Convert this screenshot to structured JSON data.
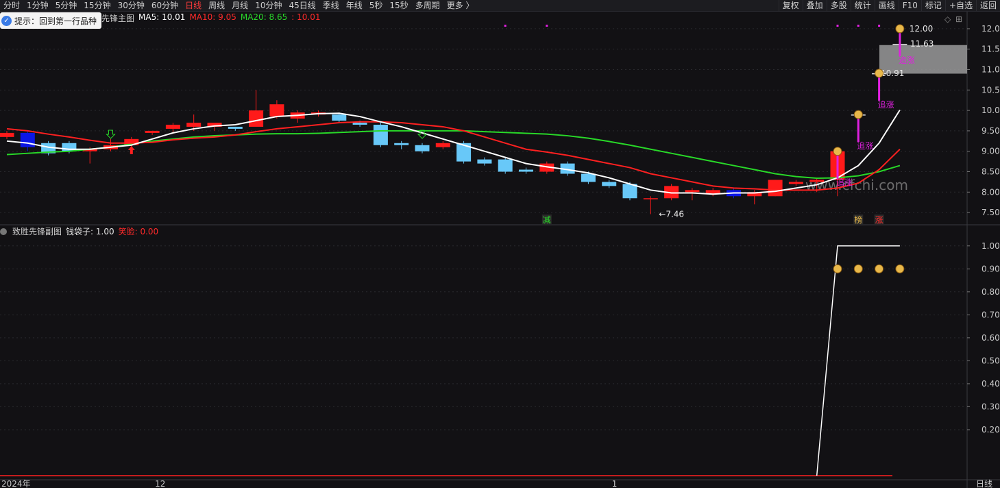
{
  "toolbar": {
    "periods": [
      "分时",
      "1分钟",
      "5分钟",
      "15分钟",
      "30分钟",
      "60分钟",
      "日线",
      "周线",
      "月线",
      "10分钟",
      "45日线",
      "季线",
      "年线",
      "5秒",
      "15秒",
      "多周期",
      "更多 〉"
    ],
    "active_period": "日线",
    "right_buttons": [
      "复权",
      "叠加",
      "多股",
      "统计",
      "画线",
      "F10",
      "标记",
      "+自选",
      "返回"
    ]
  },
  "tip": {
    "text": "提示：回到第一行品种"
  },
  "main_legend": {
    "title_partial": "先锋主图",
    "ma5": "MA5: 10.01",
    "ma10": "MA10: 9.05",
    "ma20": "MA20: 8.65",
    "extra": "10.01"
  },
  "sub_legend": {
    "title": "致胜先锋副图",
    "bag": "钱袋子: 1.00",
    "laugh": "笑脸: 0.00"
  },
  "watermark": "www.cfchi.com",
  "colors": {
    "up": "#ff1a1a",
    "down": "#68c8f8",
    "dark_down": "#0b16e6",
    "ma5": "#ffffff",
    "ma10": "#ff2020",
    "ma20": "#28d828",
    "signal": "#e020e0"
  },
  "chart_data": [
    {
      "type": "candlestick",
      "name": "main",
      "ylim": [
        7.25,
        12.2
      ],
      "yticks": [
        "12.00",
        "11.50",
        "11.00",
        "10.50",
        "10.00",
        "9.50",
        "9.00",
        "8.50",
        "8.00",
        "7.50"
      ],
      "candles": [
        [
          9.35,
          9.45,
          9.3,
          9.5
        ],
        [
          9.45,
          9.1,
          9.0,
          9.5
        ],
        [
          9.2,
          8.95,
          8.9,
          9.25
        ],
        [
          9.2,
          9.0,
          8.95,
          9.25
        ],
        [
          9.0,
          9.05,
          8.7,
          9.1
        ],
        [
          9.05,
          9.15,
          9.0,
          9.3
        ],
        [
          9.15,
          9.3,
          9.1,
          9.35
        ],
        [
          9.45,
          9.5,
          9.4,
          9.5
        ],
        [
          9.55,
          9.65,
          9.45,
          9.7
        ],
        [
          9.6,
          9.7,
          9.5,
          9.9
        ],
        [
          9.6,
          9.7,
          9.5,
          9.7
        ],
        [
          9.6,
          9.55,
          9.5,
          9.6
        ],
        [
          9.6,
          10.0,
          9.6,
          10.5
        ],
        [
          9.85,
          10.15,
          9.8,
          10.25
        ],
        [
          9.8,
          9.95,
          9.7,
          10.0
        ],
        [
          9.9,
          9.95,
          9.85,
          10.0
        ],
        [
          9.9,
          9.75,
          9.7,
          9.95
        ],
        [
          9.7,
          9.65,
          9.6,
          9.75
        ],
        [
          9.65,
          9.15,
          9.1,
          9.7
        ],
        [
          9.2,
          9.15,
          9.05,
          9.25
        ],
        [
          9.15,
          9.0,
          8.95,
          9.2
        ],
        [
          9.1,
          9.2,
          9.05,
          9.25
        ],
        [
          9.2,
          8.75,
          8.7,
          9.25
        ],
        [
          8.8,
          8.7,
          8.65,
          8.85
        ],
        [
          8.8,
          8.5,
          8.45,
          8.85
        ],
        [
          8.55,
          8.5,
          8.45,
          8.6
        ],
        [
          8.5,
          8.7,
          8.45,
          8.75
        ],
        [
          8.7,
          8.45,
          8.4,
          8.75
        ],
        [
          8.45,
          8.25,
          8.2,
          8.5
        ],
        [
          8.25,
          8.15,
          8.1,
          8.3
        ],
        [
          8.2,
          7.85,
          7.8,
          8.25
        ],
        [
          7.85,
          7.85,
          7.46,
          7.9
        ],
        [
          7.85,
          8.15,
          7.8,
          8.2
        ],
        [
          8.0,
          8.05,
          7.8,
          8.1
        ],
        [
          7.95,
          8.05,
          7.9,
          8.1
        ],
        [
          8.05,
          7.9,
          7.85,
          8.1
        ],
        [
          7.9,
          8.0,
          7.7,
          8.05
        ],
        [
          7.9,
          8.3,
          7.9,
          8.3
        ],
        [
          8.2,
          8.25,
          8.15,
          8.3
        ],
        [
          8.25,
          8.3,
          8.0,
          8.35
        ],
        [
          8.3,
          9.0,
          7.9,
          9.0
        ],
        [
          9.9,
          9.9,
          9.9,
          9.9
        ],
        [
          10.91,
          10.91,
          10.91,
          10.91
        ],
        [
          11.63,
          11.63,
          11.63,
          12.0
        ]
      ],
      "dark_down_index": [
        1,
        10,
        21,
        26,
        34,
        35
      ],
      "ma5": [
        9.25,
        9.2,
        9.1,
        9.05,
        9.05,
        9.1,
        9.15,
        9.3,
        9.45,
        9.55,
        9.62,
        9.65,
        9.75,
        9.85,
        9.88,
        9.92,
        9.93,
        9.85,
        9.72,
        9.6,
        9.45,
        9.3,
        9.15,
        9.0,
        8.85,
        8.7,
        8.62,
        8.55,
        8.47,
        8.35,
        8.2,
        8.05,
        7.98,
        7.98,
        7.95,
        7.98,
        7.98,
        8.02,
        8.1,
        8.18,
        8.35,
        8.65,
        9.2,
        10.01
      ],
      "ma10": [
        9.55,
        9.5,
        9.42,
        9.35,
        9.27,
        9.2,
        9.2,
        9.22,
        9.28,
        9.32,
        9.35,
        9.4,
        9.48,
        9.55,
        9.6,
        9.65,
        9.7,
        9.72,
        9.72,
        9.7,
        9.65,
        9.6,
        9.5,
        9.35,
        9.2,
        9.05,
        8.98,
        8.9,
        8.8,
        8.7,
        8.6,
        8.45,
        8.35,
        8.25,
        8.15,
        8.1,
        8.08,
        8.05,
        8.05,
        8.05,
        8.1,
        8.22,
        8.55,
        9.05
      ],
      "ma20": [
        8.92,
        8.95,
        8.98,
        9.0,
        9.05,
        9.1,
        9.18,
        9.25,
        9.3,
        9.35,
        9.38,
        9.4,
        9.42,
        9.43,
        9.43,
        9.44,
        9.46,
        9.48,
        9.5,
        9.5,
        9.5,
        9.5,
        9.5,
        9.48,
        9.46,
        9.44,
        9.42,
        9.38,
        9.32,
        9.24,
        9.15,
        9.05,
        8.95,
        8.85,
        8.75,
        8.65,
        8.55,
        8.45,
        8.38,
        8.34,
        8.35,
        8.4,
        8.5,
        8.65
      ],
      "price_labels": [
        {
          "text": "12.00",
          "value": 12.0
        },
        {
          "text": "11.63",
          "value": 11.63
        },
        {
          "text": "10.91",
          "value": 10.91
        },
        {
          "text": "7.46",
          "value": 7.46
        }
      ],
      "gray_box": {
        "from": 10.9,
        "to": 11.6
      },
      "signals": [
        {
          "index": 40,
          "text": "追涨"
        },
        {
          "index": 41,
          "text": "追涨"
        },
        {
          "index": 42,
          "text": "追涨"
        },
        {
          "index": 43,
          "text": "追涨"
        }
      ],
      "bottom_tags": [
        {
          "index": 26,
          "text": "减"
        },
        {
          "index": 41,
          "text": "榜"
        },
        {
          "index": 42,
          "text": "涨"
        }
      ],
      "buy_arrows": [
        6
      ],
      "hollow_down_arrows": [
        5,
        20
      ],
      "magenta_dots": [
        24,
        26,
        40,
        41,
        42
      ]
    },
    {
      "type": "line",
      "name": "sub",
      "ylim": [
        0.0,
        1.05
      ],
      "yticks": [
        "1.00",
        "0.90",
        "0.80",
        "0.70",
        "0.60",
        "0.50",
        "0.40",
        "0.30",
        "0.20"
      ],
      "values": [
        0,
        0,
        0,
        0,
        0,
        0,
        0,
        0,
        0,
        0,
        0,
        0,
        0,
        0,
        0,
        0,
        0,
        0,
        0,
        0,
        0,
        0,
        0,
        0,
        0,
        0,
        0,
        0,
        0,
        0,
        0,
        0,
        0,
        0,
        0,
        0,
        0,
        0,
        0,
        0,
        1,
        1,
        1,
        1
      ],
      "laugh": 0.0,
      "bag_icons_at": [
        40,
        41,
        42,
        43
      ],
      "bag_level": 0.9
    }
  ],
  "x_axis": {
    "labels": [
      {
        "text": "2024年",
        "index": 0
      },
      {
        "text": "12",
        "index": 7
      },
      {
        "text": "1",
        "index": 29
      }
    ],
    "right_label": "日线"
  }
}
